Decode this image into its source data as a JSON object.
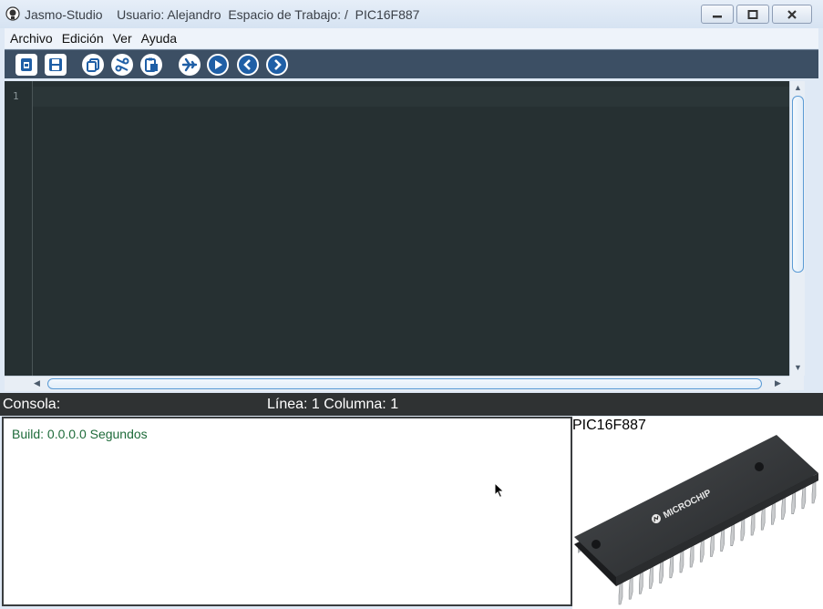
{
  "window": {
    "title": "Jasmo-Studio    Usuario: Alejandro  Espacio de Trabajo: /  PIC16F887"
  },
  "menu": {
    "items": [
      "Archivo",
      "Edición",
      "Ver",
      "Ayuda"
    ]
  },
  "toolbar": {
    "buttons": [
      "new-file",
      "save",
      "copy",
      "cut",
      "paste",
      "compile",
      "run",
      "back",
      "forward"
    ]
  },
  "editor": {
    "line_numbers": [
      "1"
    ],
    "content": ""
  },
  "status": {
    "console_label": "Consola:",
    "line_col": "Línea: 1 Columna: 1"
  },
  "console": {
    "output": "Build: 0.0.0.0 Segundos"
  },
  "device": {
    "name": "PIC16F887",
    "chip_brand": "MICROCHIP"
  },
  "colors": {
    "editor_bg": "#263032",
    "toolbar_bg": "#3c4f64",
    "status_bg": "#2f3233",
    "console_text": "#1e6b3a",
    "accent": "#1f5fa6"
  }
}
